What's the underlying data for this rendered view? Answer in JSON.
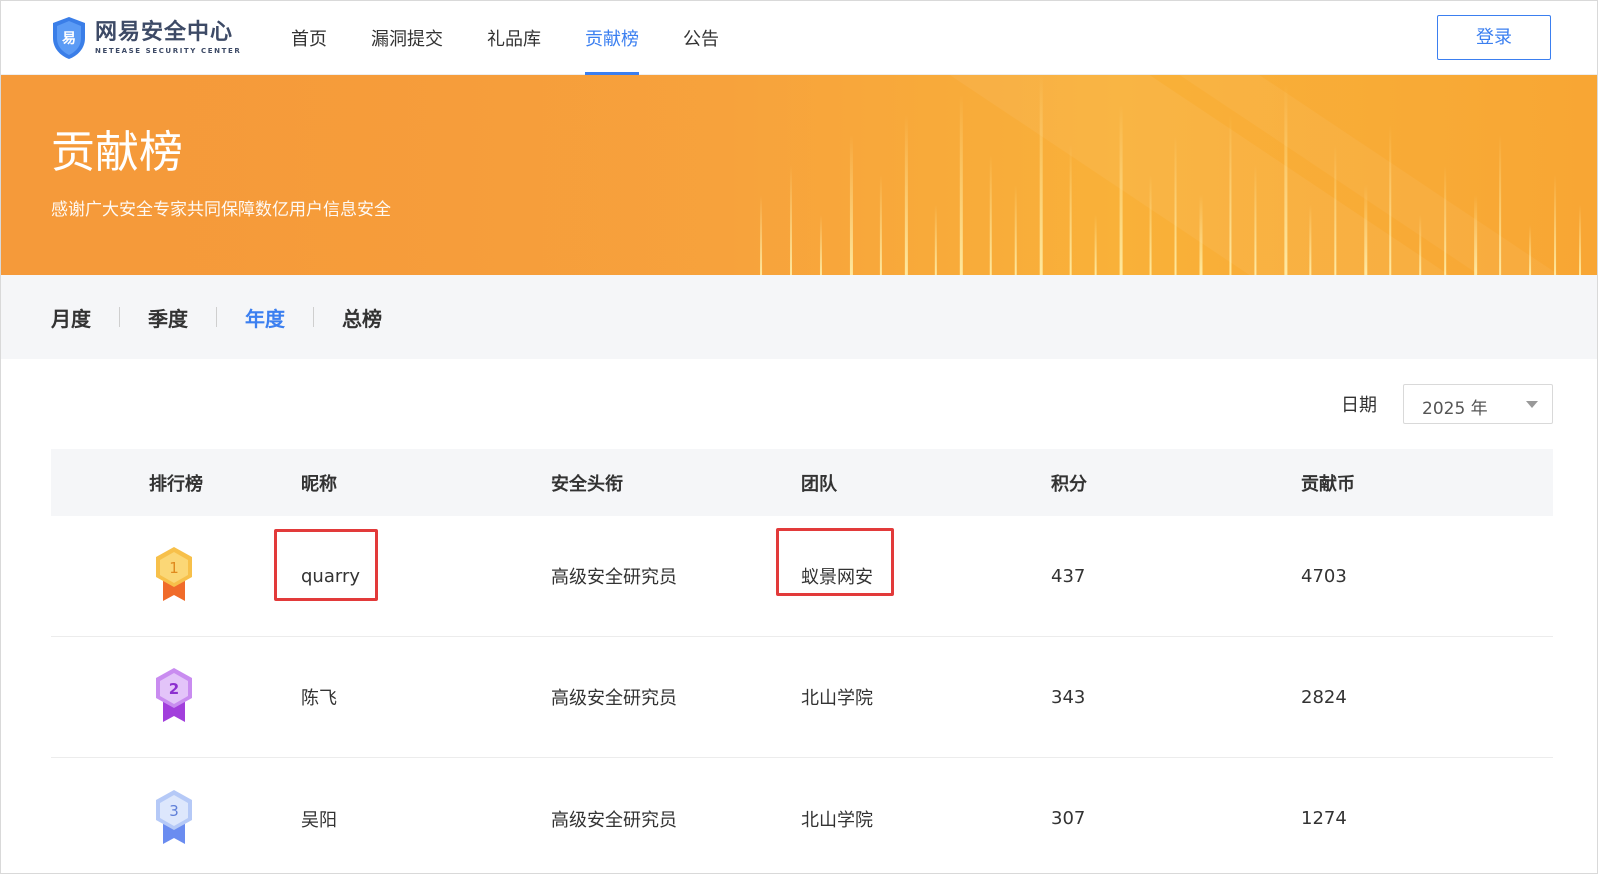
{
  "header": {
    "logo_cn": "网易安全中心",
    "logo_en": "NETEASE SECURITY CENTER",
    "nav": [
      {
        "label": "首页",
        "active": false
      },
      {
        "label": "漏洞提交",
        "active": false
      },
      {
        "label": "礼品库",
        "active": false
      },
      {
        "label": "贡献榜",
        "active": true
      },
      {
        "label": "公告",
        "active": false
      }
    ],
    "login_label": "登录"
  },
  "banner": {
    "title": "贡献榜",
    "subtitle": "感谢广大安全专家共同保障数亿用户信息安全"
  },
  "tabs": [
    {
      "label": "月度",
      "active": false
    },
    {
      "label": "季度",
      "active": false
    },
    {
      "label": "年度",
      "active": true
    },
    {
      "label": "总榜",
      "active": false
    }
  ],
  "filter": {
    "date_label": "日期",
    "date_value": "2025 年"
  },
  "table": {
    "columns": [
      "排行榜",
      "昵称",
      "安全头衔",
      "团队",
      "积分",
      "贡献币"
    ],
    "rows": [
      {
        "rank": "1",
        "nickname": "quarry",
        "title": "高级安全研究员",
        "team": "蚁景网安",
        "score": "437",
        "coins": "4703"
      },
      {
        "rank": "2",
        "nickname": "陈飞",
        "title": "高级安全研究员",
        "team": "北山学院",
        "score": "343",
        "coins": "2824"
      },
      {
        "rank": "3",
        "nickname": "吴阳",
        "title": "高级安全研究员",
        "team": "北山学院",
        "score": "307",
        "coins": "1274"
      }
    ]
  },
  "colors": {
    "accent": "#3b7ff0",
    "banner": "#f7a23c",
    "highlight": "#e23a3a",
    "gold": "#f5a623",
    "silver_purple": "#b04fe0",
    "bronze_blue": "#7fa0f0"
  }
}
